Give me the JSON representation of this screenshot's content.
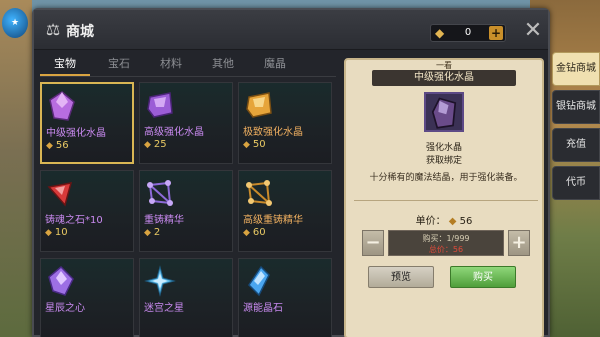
{
  "app": {
    "title": "商城",
    "currency_value": "0"
  },
  "tabs": [
    {
      "label": "宝物",
      "active": true
    },
    {
      "label": "宝石",
      "active": false
    },
    {
      "label": "材料",
      "active": false
    },
    {
      "label": "其他",
      "active": false
    },
    {
      "label": "魔晶",
      "active": false
    }
  ],
  "items": [
    {
      "name": "中级强化水晶",
      "price": "56",
      "icon": "purple-crystal-icon",
      "selected": true,
      "rarity": "purple"
    },
    {
      "name": "高级强化水晶",
      "price": "25",
      "icon": "violet-crystal-icon",
      "selected": false,
      "rarity": "purple"
    },
    {
      "name": "极致强化水晶",
      "price": "50",
      "icon": "gold-crystal-icon",
      "selected": false,
      "rarity": "orange"
    },
    {
      "name": "铸魂之石*10",
      "price": "10",
      "icon": "red-soul-stone-icon",
      "selected": false,
      "rarity": "purple"
    },
    {
      "name": "重铸精华",
      "price": "2",
      "icon": "purple-essence-icon",
      "selected": false,
      "rarity": "purple"
    },
    {
      "name": "高级重铸精华",
      "price": "60",
      "icon": "gold-essence-icon",
      "selected": false,
      "rarity": "orange"
    },
    {
      "name": "星辰之心",
      "price": "",
      "icon": "star-heart-icon",
      "selected": false,
      "rarity": "purple"
    },
    {
      "name": "迷宫之星",
      "price": "",
      "icon": "labyrinth-star-icon",
      "selected": false,
      "rarity": "purple"
    },
    {
      "name": "源能晶石",
      "price": "",
      "icon": "energy-crystal-icon",
      "selected": false,
      "rarity": "purple"
    }
  ],
  "detail": {
    "top_cap": "一看",
    "header": "中级强化水晶",
    "item_name": "强化水晶",
    "item_bind": "获取绑定",
    "description": "十分稀有的魔法结晶，用于强化装备。",
    "unit_price_label": "单价：",
    "unit_price_value": "56",
    "buy_count": "购买：1/999",
    "total": "总价：56",
    "preview_label": "预览",
    "buy_label": "购买"
  },
  "side_tabs": [
    {
      "label": "金钻商城",
      "active": true
    },
    {
      "label": "银钻商城",
      "active": false
    },
    {
      "label": "充值",
      "active": false
    },
    {
      "label": "代币",
      "active": false
    }
  ],
  "colors": {
    "accent_gold": "#d9a441",
    "rarity_purple": "#c98af0",
    "rarity_orange": "#f0b060",
    "buy_green": "#4f9e3a",
    "panel_parchment": "#e8dcc0"
  }
}
